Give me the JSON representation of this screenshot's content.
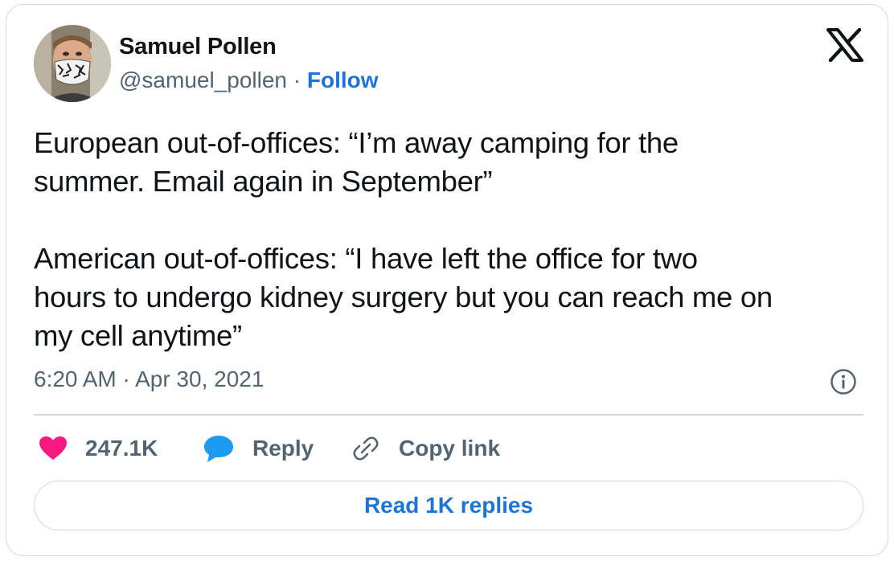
{
  "author": {
    "name": "Samuel Pollen",
    "handle": "@samuel_pollen",
    "separator": " · ",
    "follow_label": "Follow"
  },
  "tweet": {
    "text": "European out-of-offices: “I’m away camping for the\nsummer. Email again in September”\n\nAmerican out-of-offices: “I have left the office for two\nhours to undergo kidney surgery but you can reach me on\nmy cell anytime”",
    "timestamp": "6:20 AM · Apr 30, 2021"
  },
  "actions": {
    "like_count": "247.1K",
    "reply_label": "Reply",
    "copy_link_label": "Copy link"
  },
  "footer": {
    "read_replies_label": "Read 1K replies"
  },
  "icons": {
    "platform_logo": "x-logo-icon",
    "info": "info-icon",
    "like": "heart-icon",
    "reply": "speech-bubble-icon",
    "copy_link": "link-icon"
  },
  "colors": {
    "link_blue": "#1d74d8",
    "heart_pink": "#f91880",
    "reply_blue": "#1d9bf0",
    "text_primary": "#0f1419",
    "text_secondary": "#536471",
    "border": "#cfd9de"
  }
}
